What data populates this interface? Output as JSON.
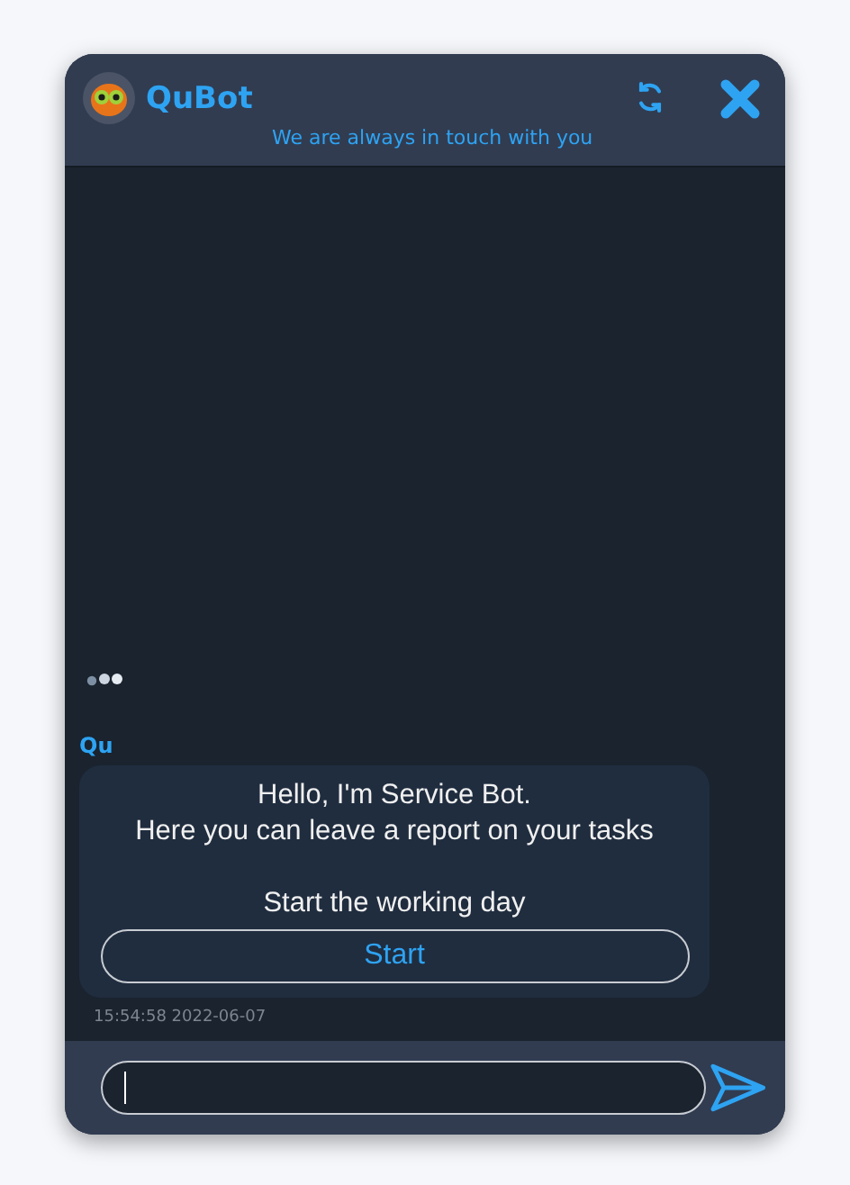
{
  "header": {
    "title": "QuBot",
    "subtitle": "We are always in touch with you"
  },
  "messages": [
    {
      "sender": "Qu",
      "lines": [
        "Hello, I'm Service Bot.",
        "Here you can leave a report on your tasks"
      ],
      "prompt": "Start the working day",
      "button": "Start",
      "time": "15:54:58 2022-06-07"
    }
  ]
}
